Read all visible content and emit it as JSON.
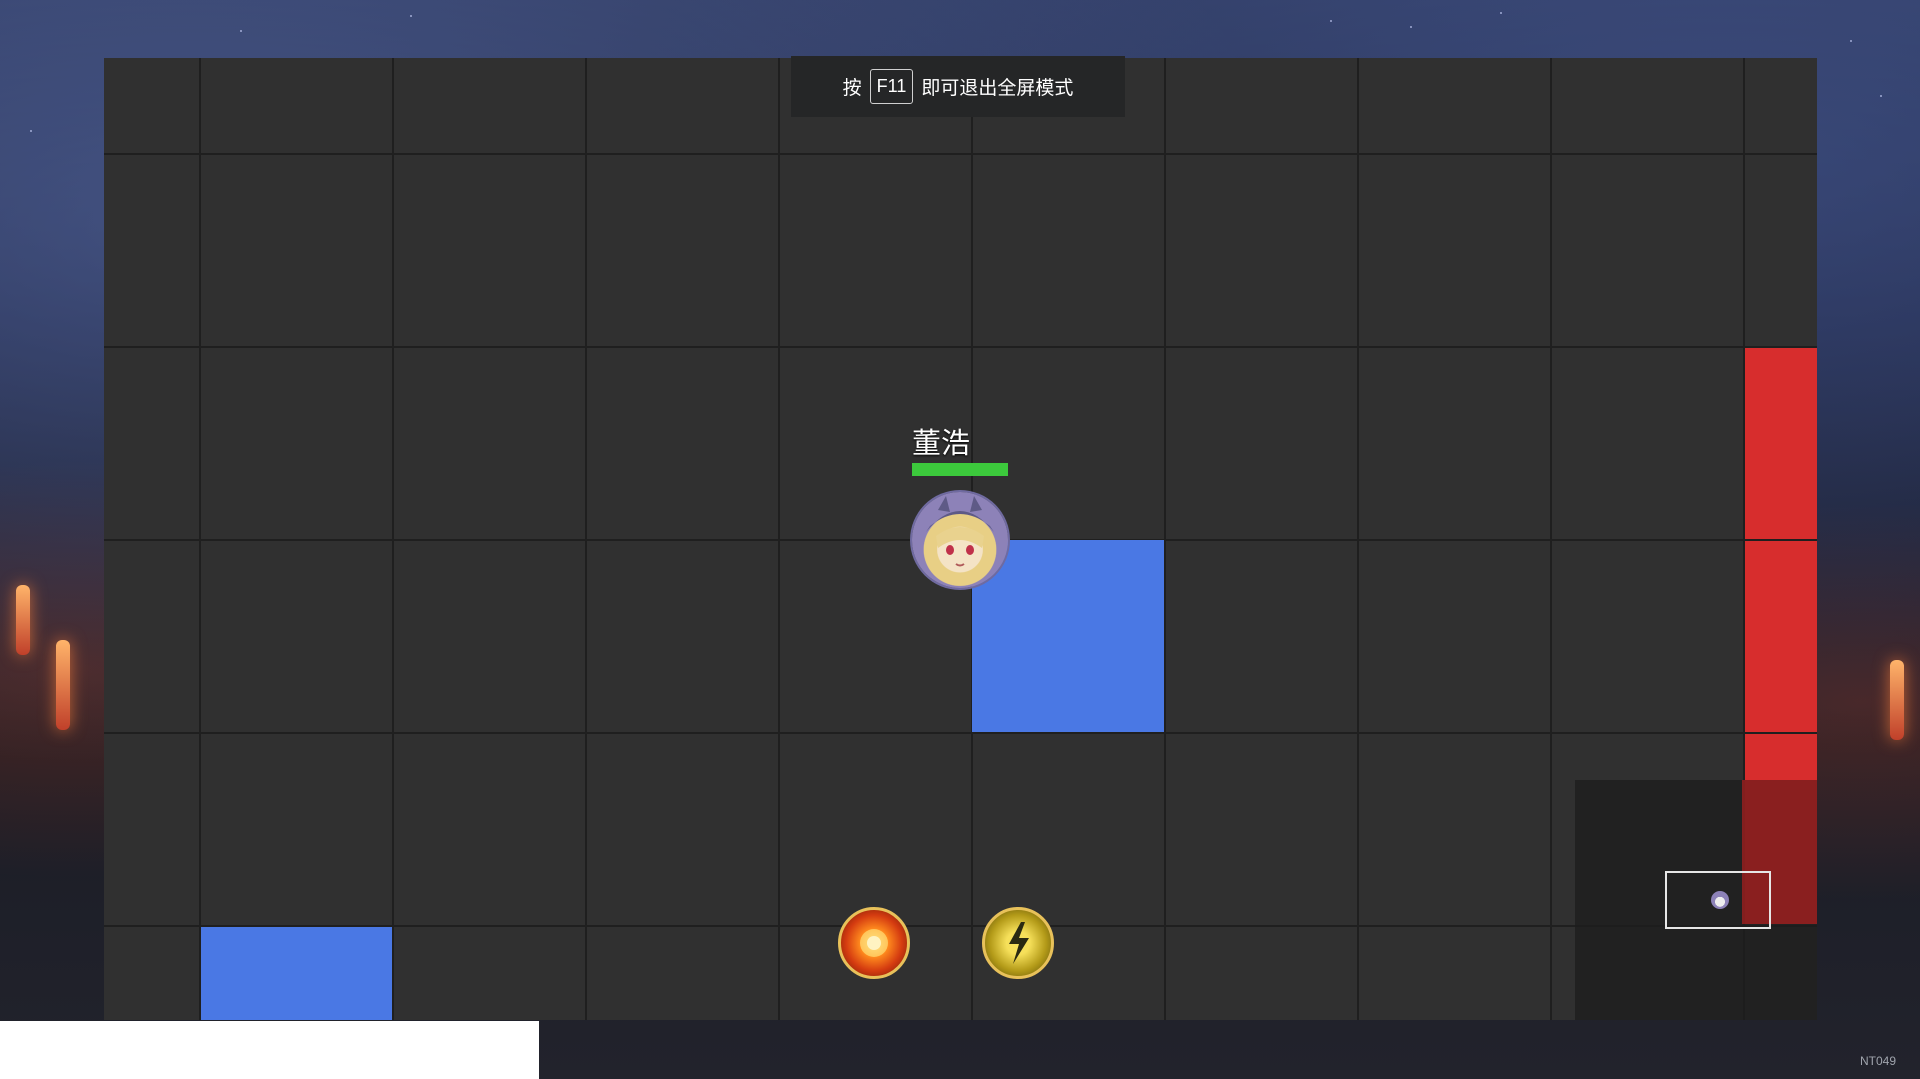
{
  "fullscreen_hint": {
    "prefix": "按",
    "key": "F11",
    "suffix": "即可退出全屏模式"
  },
  "player": {
    "name": "董浩",
    "health_fraction": 1.0,
    "icon": "anime-girl-avatar"
  },
  "skills": [
    {
      "icon": "fireball-icon"
    },
    {
      "icon": "lightning-icon"
    }
  ],
  "minimap": {
    "player_icon": "player-marker-icon"
  },
  "corner_label": "NT049",
  "colors": {
    "board": "#303030",
    "grid_line": "#1f1f1f",
    "blue_tile": "#4a78e4",
    "red_tile": "#d72d2d",
    "health": "#3cc93c",
    "orb_rim": "#e8c15a"
  }
}
